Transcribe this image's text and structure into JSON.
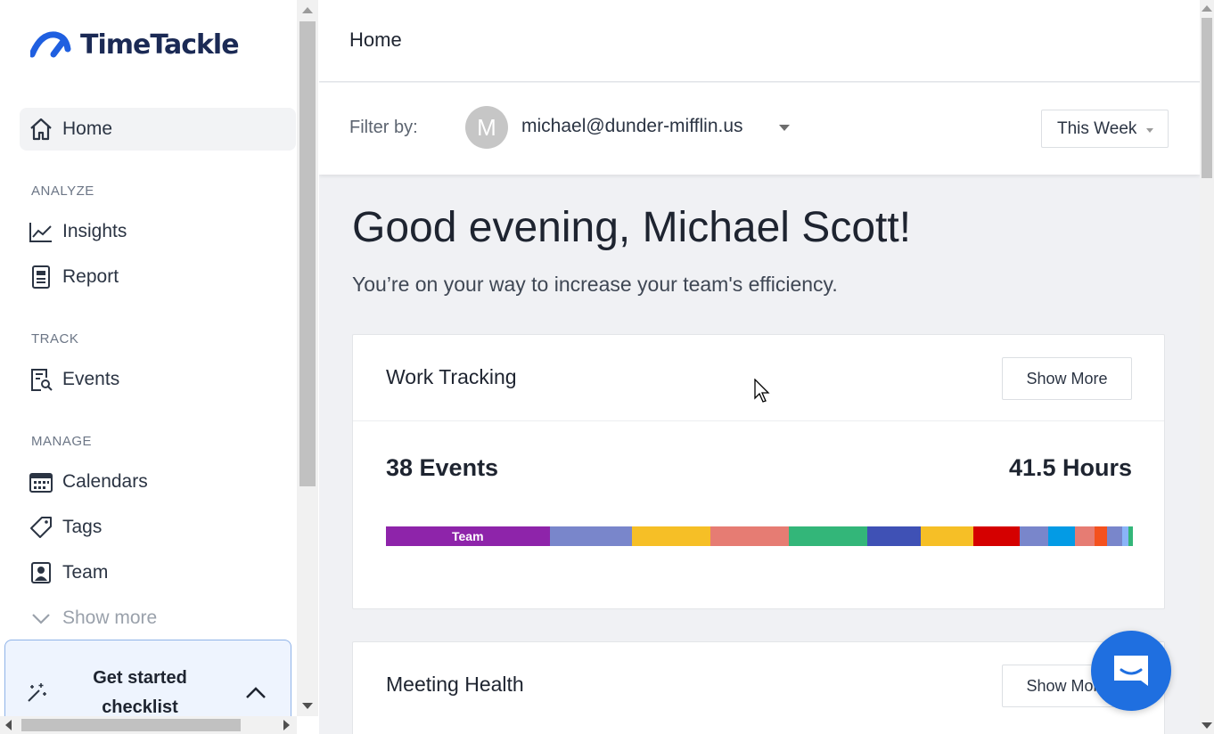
{
  "app": {
    "logo_text": "TimeTackle"
  },
  "sidebar": {
    "home_label": "Home",
    "sections": {
      "analyze": "ANALYZE",
      "track": "TRACK",
      "manage": "MANAGE"
    },
    "items": {
      "insights": "Insights",
      "report": "Report",
      "events": "Events",
      "calendars": "Calendars",
      "tags": "Tags",
      "team": "Team",
      "show_more": "Show more"
    },
    "checklist_label": "Get started checklist"
  },
  "header": {
    "title": "Home"
  },
  "filter": {
    "label": "Filter by:",
    "avatar_initial": "M",
    "user_email": "michael@dunder-mifflin.us",
    "period": "This Week"
  },
  "greeting": {
    "title": "Good evening, Michael Scott!",
    "subtitle": "You’re on your way to increase your team's efficiency."
  },
  "work_tracking": {
    "title": "Work Tracking",
    "button": "Show More",
    "events": "38 Events",
    "hours": "41.5 Hours",
    "segments": [
      {
        "label": "Team",
        "color": "#8e24aa",
        "share": 0.219
      },
      {
        "label": "",
        "color": "#7986cb",
        "share": 0.11
      },
      {
        "label": "",
        "color": "#f6bf26",
        "share": 0.105
      },
      {
        "label": "",
        "color": "#e67c73",
        "share": 0.105
      },
      {
        "label": "",
        "color": "#33b679",
        "share": 0.105
      },
      {
        "label": "",
        "color": "#3f51b5",
        "share": 0.072
      },
      {
        "label": "",
        "color": "#f6bf26",
        "share": 0.07
      },
      {
        "label": "",
        "color": "#d50000",
        "share": 0.062
      },
      {
        "label": "",
        "color": "#7986cb",
        "share": 0.039
      },
      {
        "label": "",
        "color": "#039be5",
        "share": 0.036
      },
      {
        "label": "",
        "color": "#e67c73",
        "share": 0.026
      },
      {
        "label": "",
        "color": "#f4511e",
        "share": 0.017
      },
      {
        "label": "",
        "color": "#7986cb",
        "share": 0.02
      },
      {
        "label": "",
        "color": "#8ab4f8",
        "share": 0.008
      },
      {
        "label": "",
        "color": "#33b679",
        "share": 0.006
      }
    ]
  },
  "meeting_health": {
    "title": "Meeting Health",
    "button": "Show More"
  },
  "colors": {
    "brand": "#1b2a55",
    "accent": "#1f6fe0"
  }
}
